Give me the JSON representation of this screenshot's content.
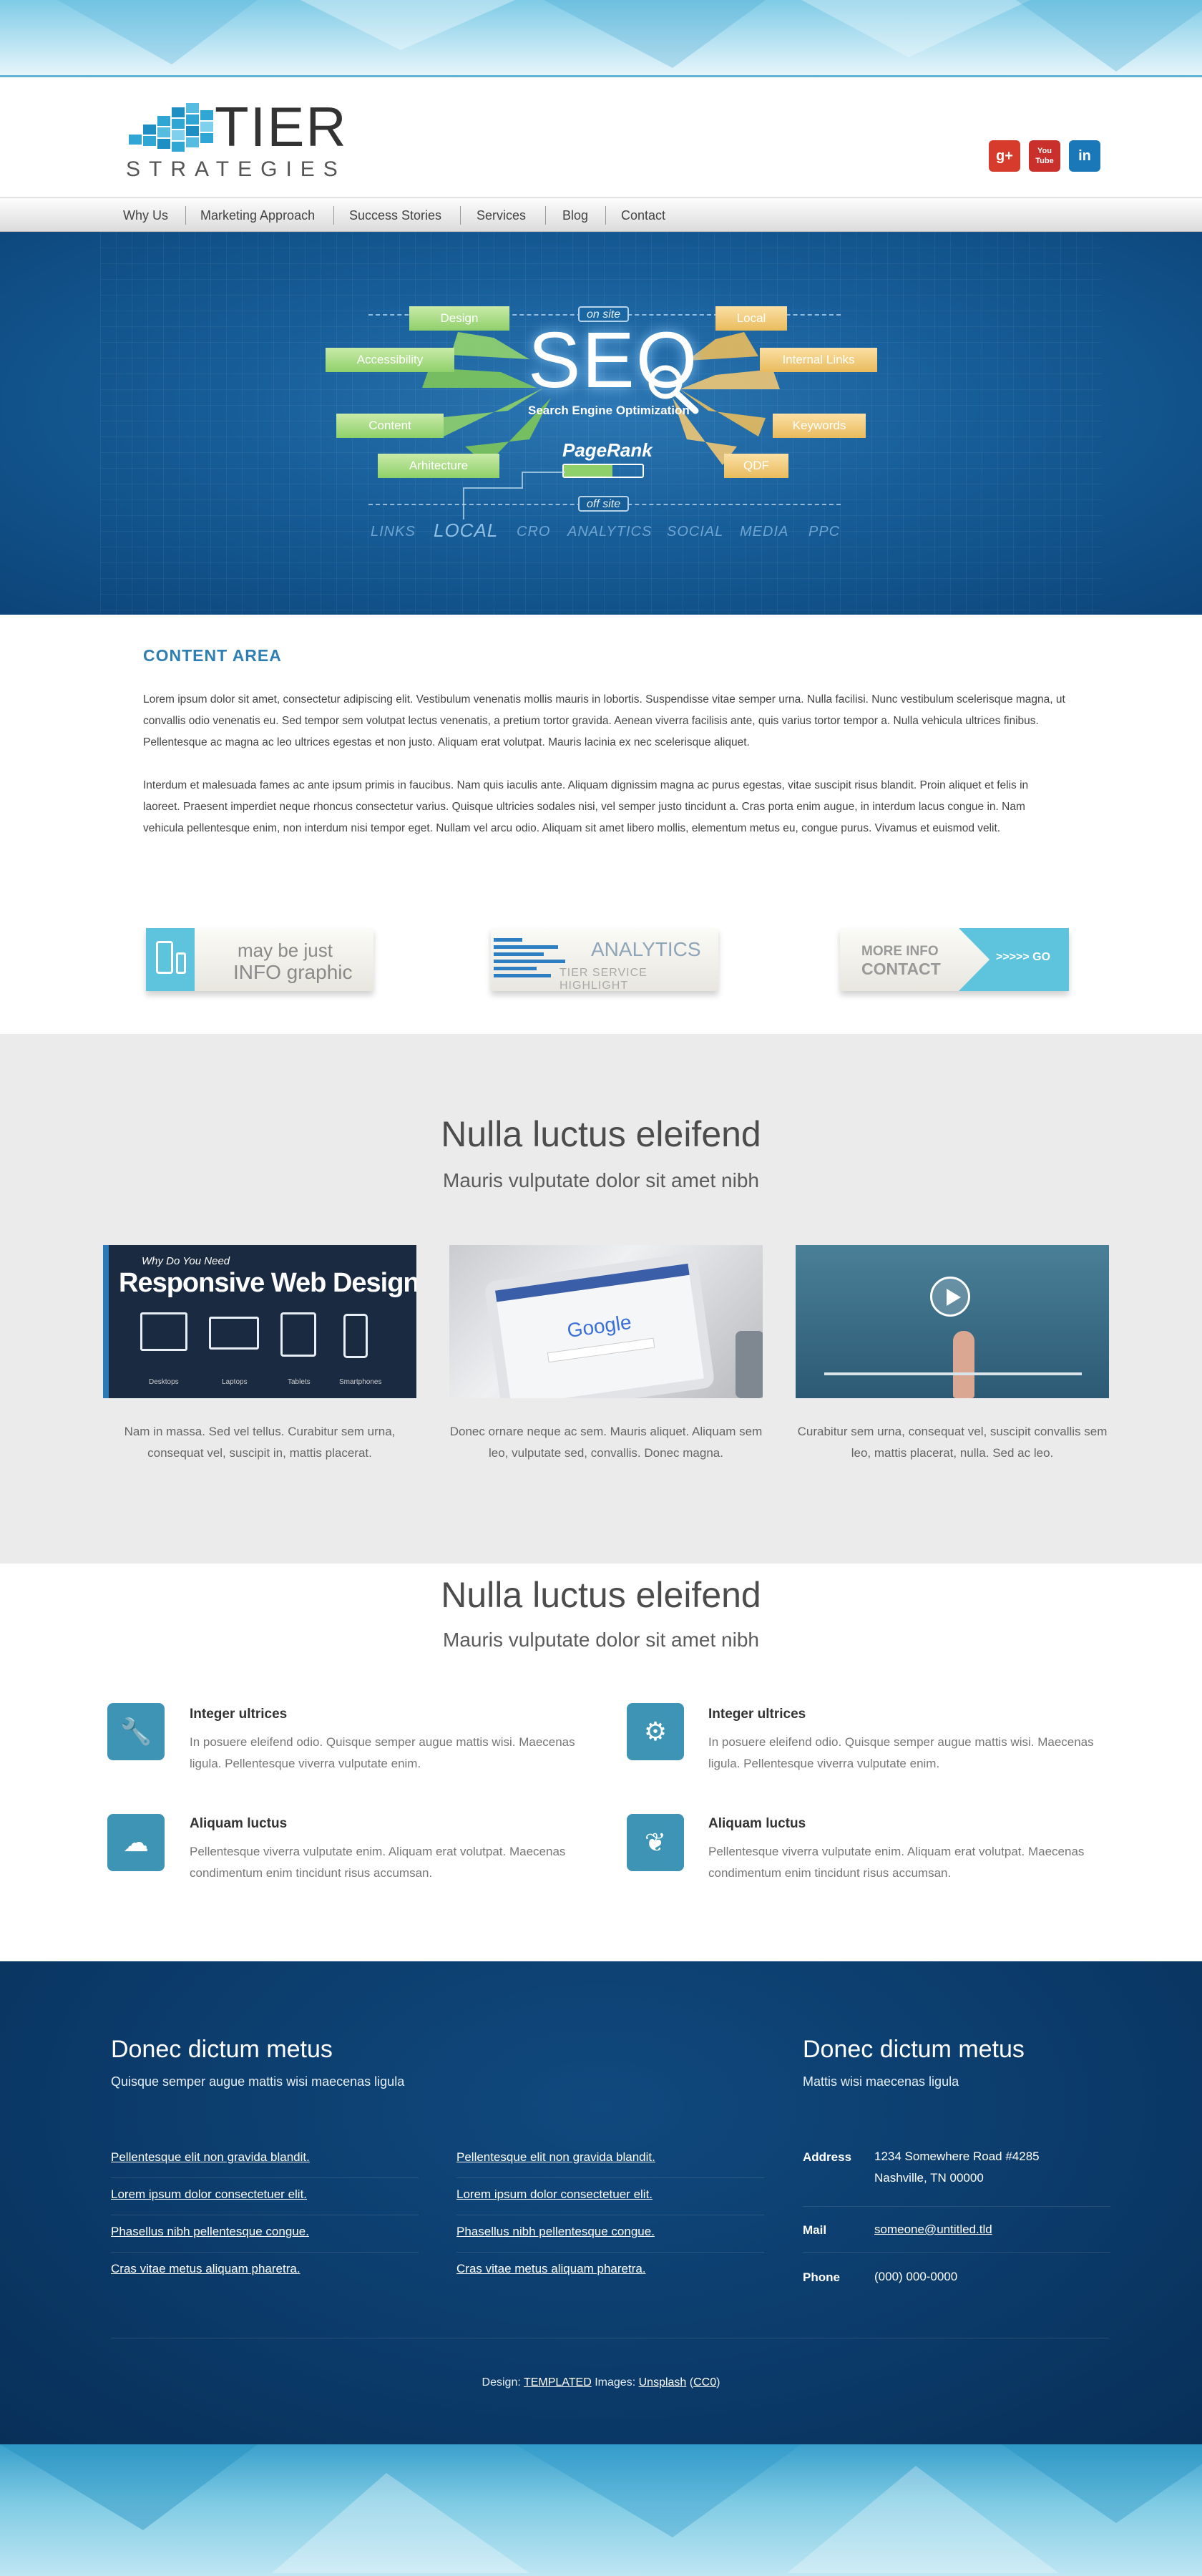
{
  "header": {
    "logo_word": "TIER",
    "logo_sub": "STRATEGIES",
    "social": [
      {
        "name": "google-plus",
        "label": "g+",
        "color": "#d63b2b"
      },
      {
        "name": "youtube",
        "label": "You Tube",
        "color": "#c9302c"
      },
      {
        "name": "linkedin",
        "label": "in",
        "color": "#1a78b8"
      }
    ]
  },
  "nav": {
    "items": [
      "Why Us",
      "Marketing Approach",
      "Success Stories",
      "Services",
      "Blog",
      "Contact"
    ]
  },
  "hero": {
    "seo": "SEO",
    "seo_sub": "Search Engine Optimization",
    "pagerank": "PageRank",
    "on_site": "on site",
    "off_site": "off site",
    "left_tags": [
      "Design",
      "Accessibility",
      "Content",
      "Arhitecture"
    ],
    "right_tags": [
      "Local",
      "Internal Links",
      "Keywords",
      "QDF"
    ],
    "keywords": [
      "LINKS",
      "LOCAL",
      "CRO",
      "ANALYTICS",
      "SOCIAL",
      "MEDIA",
      "PPC"
    ]
  },
  "content": {
    "title": "CONTENT AREA",
    "p1": "Lorem ipsum dolor sit amet, consectetur adipiscing elit. Vestibulum venenatis mollis mauris in lobortis. Suspendisse vitae semper urna. Nulla facilisi. Nunc vestibulum scelerisque magna, ut convallis odio venenatis eu. Sed tempor sem volutpat lectus venenatis, a pretium tortor gravida. Aenean viverra facilisis ante, quis varius tortor tempor a. Nulla vehicula ultrices finibus. Pellentesque ac magna ac leo ultrices egestas et non justo. Aliquam erat volutpat. Mauris lacinia ex nec scelerisque aliquet.",
    "p2": "Interdum et malesuada fames ac ante ipsum primis in faucibus. Nam quis iaculis ante. Aliquam dignissim magna ac purus egestas, vitae suscipit risus blandit. Proin aliquet et felis in laoreet. Praesent imperdiet neque rhoncus consectetur varius. Quisque ultricies sodales nisi, vel semper justo tincidunt a. Cras porta enim augue, in interdum lacus congue in. Nam vehicula pellentesque enim, non interdum nisi tempor eget. Nullam vel arcu odio. Aliquam sit amet libero mollis, elementum metus eu, congue purus. Vivamus et euismod velit."
  },
  "banners": {
    "info_line1": "may be just",
    "info_line2": "INFO graphic",
    "analytics_line1": "ANALYTICS",
    "analytics_line2": "TIER SERVICE HIGHLIGHT",
    "contact_line1": "MORE INFO",
    "contact_line2": "CONTACT",
    "contact_go": ">>>>> GO"
  },
  "gallery": {
    "heading": "Nulla luctus eleifend",
    "subheading": "Mauris vulputate dolor sit amet nibh",
    "rwd_small": "Why Do You Need",
    "rwd_title": "Responsive Web Design",
    "rwd_devices": [
      "Desktops",
      "Laptops",
      "Tablets",
      "Smartphones"
    ],
    "google_text": "Google",
    "captions": [
      "Nam in massa. Sed vel tellus. Curabitur sem urna, consequat vel, suscipit in, mattis placerat.",
      "Donec ornare neque ac sem. Mauris aliquet. Aliquam sem leo, vulputate sed, convallis. Donec magna.",
      "Curabitur sem urna, consequat vel, suscipit convallis sem leo, mattis placerat, nulla. Sed ac leo."
    ]
  },
  "features": {
    "heading": "Nulla luctus eleifend",
    "subheading": "Mauris vulputate dolor sit amet nibh",
    "items": [
      {
        "icon": "wrench-icon",
        "glyph": "🔧",
        "title": "Integer ultrices",
        "text": "In posuere eleifend odio. Quisque semper augue mattis wisi. Maecenas ligula. Pellentesque viverra vulputate enim."
      },
      {
        "icon": "cogs-icon",
        "glyph": "⚙",
        "title": "Integer ultrices",
        "text": "In posuere eleifend odio. Quisque semper augue mattis wisi. Maecenas ligula. Pellentesque viverra vulputate enim."
      },
      {
        "icon": "cloud-icon",
        "glyph": "☁",
        "title": "Aliquam luctus",
        "text": "Pellentesque viverra vulputate enim. Aliquam erat volutpat. Maecenas condimentum enim tincidunt risus accumsan."
      },
      {
        "icon": "leaf-icon",
        "glyph": "❦",
        "title": "Aliquam luctus",
        "text": "Pellentesque viverra vulputate enim. Aliquam erat volutpat. Maecenas condimentum enim tincidunt risus accumsan."
      }
    ]
  },
  "footer": {
    "left_heading": "Donec dictum metus",
    "left_sub": "Quisque semper augue mattis wisi maecenas ligula",
    "links_col1": [
      "Pellentesque elit non gravida blandit.",
      "Lorem ipsum dolor consectetuer elit.",
      "Phasellus nibh pellentesque congue.",
      "Cras vitae metus aliquam pharetra."
    ],
    "links_col2": [
      "Pellentesque elit non gravida blandit.",
      "Lorem ipsum dolor consectetuer elit.",
      "Phasellus nibh pellentesque congue.",
      "Cras vitae metus aliquam pharetra."
    ],
    "right_heading": "Donec dictum metus",
    "right_sub": "Mattis wisi maecenas ligula",
    "address_label": "Address",
    "address_line1": "1234 Somewhere Road #4285",
    "address_line2": "Nashville, TN 00000",
    "mail_label": "Mail",
    "mail_value": "someone@untitled.tld",
    "phone_label": "Phone",
    "phone_value": "(000) 000-0000",
    "credit_design_label": "Design:",
    "credit_design_link": "TEMPLATED",
    "credit_images_label": "Images:",
    "credit_images_link": "Unsplash",
    "credit_license": "CC0"
  },
  "colors": {
    "accent_blue": "#2e7fb3",
    "icon_teal": "#3d94b5",
    "footer_navy": "#0b3a69"
  }
}
